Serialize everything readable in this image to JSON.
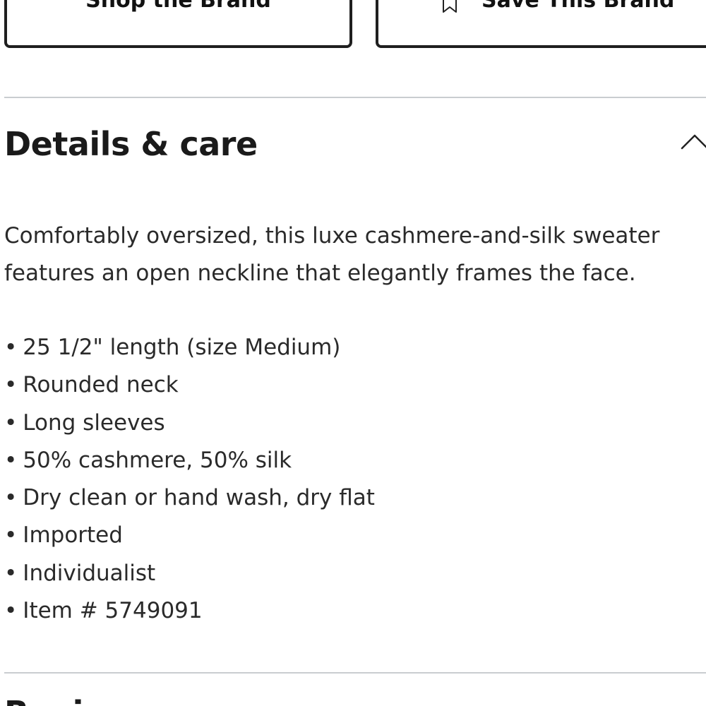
{
  "brand_actions": {
    "shop_label": "Shop the Brand",
    "save_label": "Save This Brand",
    "save_icon": "bookmark-icon"
  },
  "details": {
    "title": "Details & care",
    "toggle_icon": "chevron-up-icon",
    "description_lines": [
      "Comfortably oversized, this luxe cashmere-and-silk sweater",
      "features an open neckline that elegantly frames the face."
    ],
    "bullet_char": "•",
    "bullets": [
      "25 1/2\" length (size Medium)",
      "Rounded neck",
      "Long sleeves",
      "50% cashmere, 50% silk",
      "Dry clean or hand wash, dry flat",
      "Imported",
      "Individualist",
      "Item # 5749091"
    ]
  },
  "next_section": {
    "title_partial": "Revi"
  }
}
